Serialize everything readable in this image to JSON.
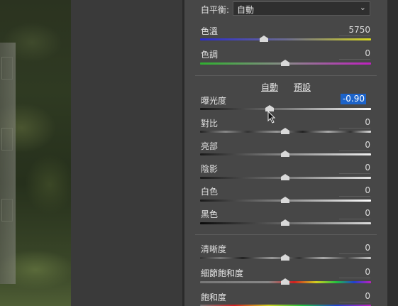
{
  "white_balance": {
    "label": "白平衡:",
    "value": "自動"
  },
  "links": {
    "auto": "自動",
    "default": "預設"
  },
  "sliders_top": [
    {
      "label": "色溫",
      "value": "5750",
      "position": 0.38
    },
    {
      "label": "色調",
      "value": "0",
      "position": 0.5
    }
  ],
  "sliders_tone": [
    {
      "label": "曝光度",
      "value": "-0.90",
      "position": 0.41,
      "active": true
    },
    {
      "label": "對比",
      "value": "0",
      "position": 0.5
    },
    {
      "label": "亮部",
      "value": "0",
      "position": 0.5
    },
    {
      "label": "陰影",
      "value": "0",
      "position": 0.5
    },
    {
      "label": "白色",
      "value": "0",
      "position": 0.5
    },
    {
      "label": "黑色",
      "value": "0",
      "position": 0.5
    }
  ],
  "sliders_presence": [
    {
      "label": "清晰度",
      "value": "0",
      "position": 0.5
    },
    {
      "label": "細節飽和度",
      "value": "0",
      "position": 0.5
    },
    {
      "label": "飽和度",
      "value": "0",
      "position": 0.5
    }
  ],
  "colors": {
    "temp_track": "#2a2ad0 → #d8d820",
    "tint_track": "#2fb02f → #c020c0",
    "active_value": "#1c63c9"
  }
}
